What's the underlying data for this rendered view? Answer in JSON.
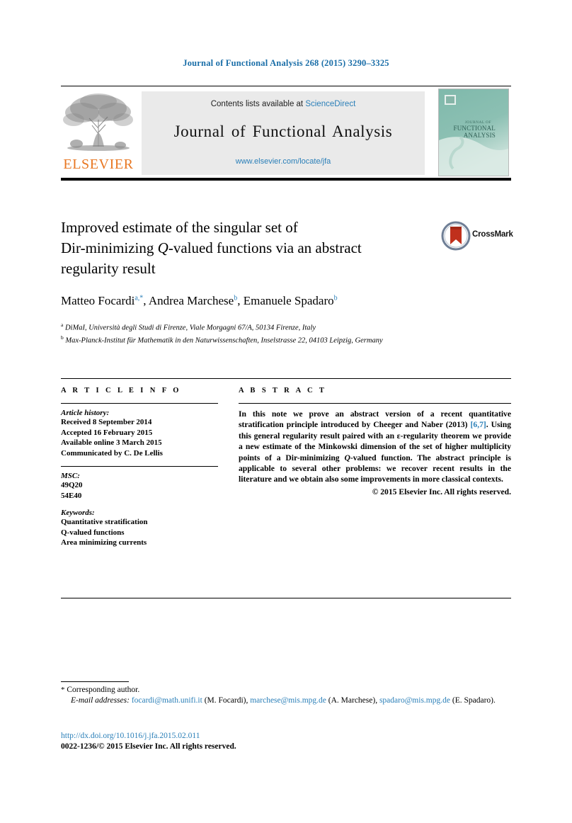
{
  "running_head": "Journal of Functional Analysis 268 (2015) 3290–3325",
  "masthead": {
    "contents_prefix": "Contents lists available at ",
    "sciencedirect": "ScienceDirect",
    "journal_name": "Journal of Functional Analysis",
    "journal_url": "www.elsevier.com/locate/jfa",
    "publisher_wordmark": "ELSEVIER",
    "cover": {
      "line1": "JOURNAL OF",
      "line2": "FUNCTIONAL",
      "line3": "ANALYSIS"
    },
    "colors": {
      "link": "#2a7fb8",
      "elsevier_orange": "#e87722",
      "banner_bg": "#eaeaea",
      "cover_teal": "#7cb6a8"
    }
  },
  "article": {
    "title_line1": "Improved estimate of the singular set of",
    "title_line2_a": "Dir-minimizing ",
    "title_line2_q": "Q",
    "title_line2_b": "-valued functions via an abstract",
    "title_line3": "regularity result",
    "crossmark_label": "CrossMark",
    "authors": [
      {
        "name": "Matteo Focardi",
        "marks": "a,*"
      },
      {
        "name": "Andrea Marchese",
        "marks": "b"
      },
      {
        "name": "Emanuele Spadaro",
        "marks": "b"
      }
    ],
    "affiliations": [
      {
        "mark": "a",
        "text": "DiMaI, Università degli Studi di Firenze, Viale Morgagni 67/A, 50134 Firenze, Italy"
      },
      {
        "mark": "b",
        "text": "Max-Planck-Institut für Mathematik in den Naturwissenschaften, Inselstrasse 22, 04103 Leipzig, Germany"
      }
    ]
  },
  "info": {
    "heading": "A R T I C L E  I N F O",
    "history_label": "Article history:",
    "history": [
      "Received 8 September 2014",
      "Accepted 16 February 2015",
      "Available online 3 March 2015",
      "Communicated by C. De Lellis"
    ],
    "msc_label": "MSC:",
    "msc": [
      "49Q20",
      "54E40"
    ],
    "keywords_label": "Keywords:",
    "keywords": [
      "Quantitative stratification",
      "Q-valued functions",
      "Area minimizing currents"
    ]
  },
  "abstract": {
    "heading": "A B S T R A C T",
    "part1": "In this note we prove an abstract version of a recent quantitative stratification principle introduced by Cheeger and Naber (2013) ",
    "citation": "[6,7]",
    "part2": ". Using this general regularity result paired with an ε-regularity theorem we provide a new estimate of the Minkowski dimension of the set of higher multiplicity points of a Dir-minimizing ",
    "q_symbol": "Q",
    "part3": "-valued function. The abstract principle is applicable to several other problems: we recover recent results in the literature and we obtain also some improvements in more classical contexts.",
    "copyright": "© 2015 Elsevier Inc. All rights reserved."
  },
  "footer": {
    "corresponding_marker": "*",
    "corresponding_text": "Corresponding author.",
    "email_label": "E-mail addresses:",
    "emails": [
      {
        "address": "focardi@math.unifi.it",
        "owner": "(M. Focardi)"
      },
      {
        "address": "marchese@mis.mpg.de",
        "owner": "(A. Marchese)"
      },
      {
        "address": "spadaro@mis.mpg.de",
        "owner": "(E. Spadaro)."
      }
    ],
    "doi": "http://dx.doi.org/10.1016/j.jfa.2015.02.011",
    "issn_line": "0022-1236/© 2015 Elsevier Inc. All rights reserved."
  }
}
